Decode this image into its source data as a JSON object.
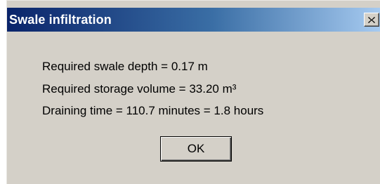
{
  "window": {
    "title": "Swale infiltration",
    "close_icon": "close-icon"
  },
  "message": {
    "line1": "Required swale depth = 0.17 m",
    "line2": "Required storage volume = 33.20 m³",
    "line3": "Draining time = 110.7 minutes = 1.8 hours"
  },
  "buttons": {
    "ok_label": "OK"
  },
  "colors": {
    "title_gradient_start": "#0a246a",
    "title_gradient_end": "#a6caf0",
    "dialog_background": "#d4d0c8"
  }
}
